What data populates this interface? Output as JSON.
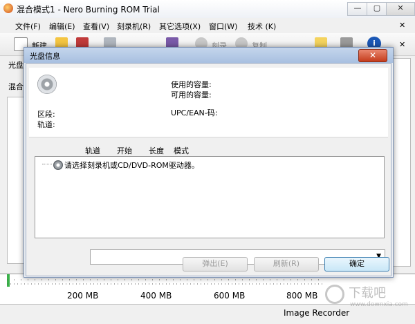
{
  "window": {
    "title": "混合模式1 - Nero Burning ROM Trial",
    "min": "—",
    "max": "▢",
    "close": "✕"
  },
  "menu": [
    {
      "label": "文件(F)"
    },
    {
      "label": "编辑(E)"
    },
    {
      "label": "查看(V)"
    },
    {
      "label": "刻录机(R)"
    },
    {
      "label": "其它选项(X)"
    },
    {
      "label": "窗口(W)"
    },
    {
      "label": "技术 (K)"
    }
  ],
  "menu_close": "✕",
  "toolbar": {
    "new_label": "新建",
    "burn_label": "刻录",
    "copy_label": "复制"
  },
  "background_labels": {
    "left_tab": "光盘",
    "left_name": "混合"
  },
  "scale": {
    "labels": [
      "200 MB",
      "400 MB",
      "600 MB",
      "800 MB"
    ]
  },
  "status": {
    "recorder": "Image Recorder"
  },
  "watermark": {
    "text": "下载吧",
    "url": "www.downxia.com"
  },
  "dialog": {
    "title": "光盘信息",
    "close": "✕",
    "used_capacity": "使用的容量:",
    "free_capacity": "可用的容量:",
    "upc_ean": "UPC/EAN-码:",
    "section": "区段:",
    "track": "轨道:",
    "columns": [
      "轨道",
      "开始",
      "长度",
      "模式"
    ],
    "message": "请选择刻录机或CD/DVD-ROM驱动器。",
    "drive_value": "",
    "eject_button": "弹出(E)",
    "refresh_button": "刷新(R)",
    "ok_button": "确定"
  }
}
